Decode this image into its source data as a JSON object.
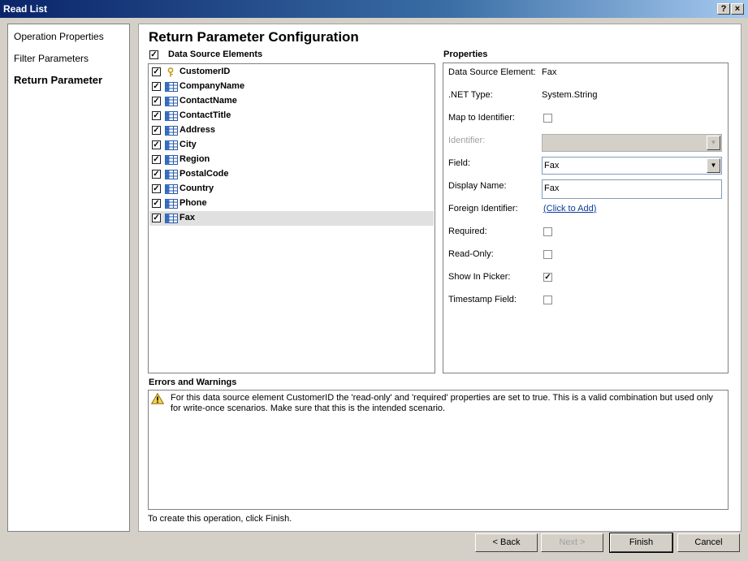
{
  "window": {
    "title": "Read List",
    "help_glyph": "?",
    "close_glyph": "×"
  },
  "nav": {
    "items": [
      "Operation Properties",
      "Filter Parameters",
      "Return Parameter"
    ]
  },
  "main": {
    "heading": "Return Parameter Configuration"
  },
  "data_source": {
    "header_label": "Data Source Elements",
    "check_glyph": "✓",
    "items": [
      "CustomerID",
      "CompanyName",
      "ContactName",
      "ContactTitle",
      "Address",
      "City",
      "Region",
      "PostalCode",
      "Country",
      "Phone",
      "Fax"
    ]
  },
  "properties": {
    "header": "Properties",
    "data_source_element_label": "Data Source Element:",
    "data_source_element_value": "Fax",
    "net_type_label": ".NET Type:",
    "net_type_value": "System.String",
    "map_to_identifier_label": "Map to Identifier:",
    "identifier_label": "Identifier:",
    "identifier_value": "",
    "field_label": "Field:",
    "field_value": "Fax",
    "display_name_label": "Display Name:",
    "display_name_value": "Fax",
    "foreign_identifier_label": "Foreign Identifier:",
    "foreign_identifier_link": "(Click to Add)",
    "required_label": "Required:",
    "read_only_label": "Read-Only:",
    "show_in_picker_label": "Show In Picker:",
    "timestamp_field_label": "Timestamp Field:",
    "dropdown_glyph": "▼"
  },
  "errors": {
    "header": "Errors and Warnings",
    "message": "For this data source element CustomerID the 'read-only' and 'required' properties are set to true. This is a valid combination but used only for write-once scenarios. Make sure that this is the intended scenario."
  },
  "footer": {
    "hint": "To create this operation, click Finish."
  },
  "buttons": {
    "back": "< Back",
    "next": "Next >",
    "finish": "Finish",
    "cancel": "Cancel"
  }
}
